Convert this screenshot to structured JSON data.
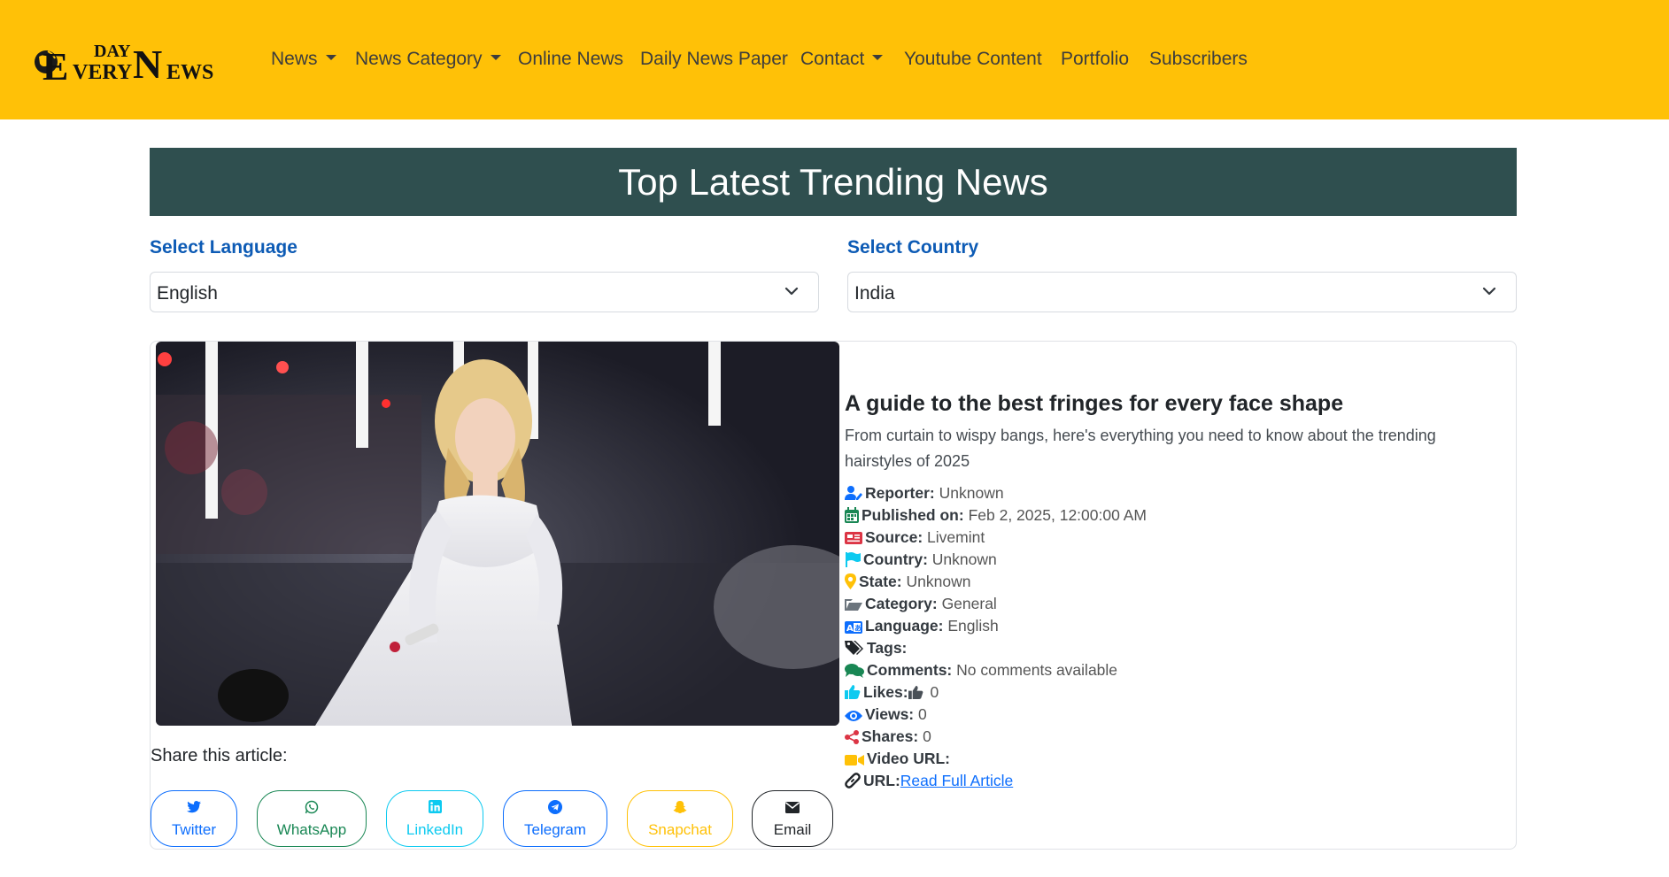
{
  "brand": {
    "logo_text_top": "DAY",
    "logo_text_e": "E",
    "logo_text_very": "VERY",
    "logo_text_n": "N",
    "logo_text_ews": "EWS"
  },
  "nav": {
    "items": [
      {
        "label": "News"
      },
      {
        "label": "News Category"
      },
      {
        "label": "Online News"
      },
      {
        "label": "Daily News Paper"
      },
      {
        "label": "Contact"
      },
      {
        "label": "Youtube Content"
      },
      {
        "label": "Portfolio"
      },
      {
        "label": "Subscribers"
      }
    ]
  },
  "banner": {
    "title": "Top Latest Trending News"
  },
  "filters": {
    "language_label": "Select Language",
    "language_value": "English",
    "country_label": "Select Country",
    "country_value": "India"
  },
  "article": {
    "title": "A guide to the best fringes for every face shape",
    "description": "From curtain to wispy bangs, here's everything you need to know about the trending hairstyles of 2025",
    "reporter_label": "Reporter:",
    "reporter": "Unknown",
    "published_label": "Published on:",
    "published": "Feb 2, 2025, 12:00:00 AM",
    "source_label": "Source:",
    "source": "Livemint",
    "country_label": "Country:",
    "country": "Unknown",
    "state_label": "State:",
    "state": "Unknown",
    "category_label": "Category:",
    "category": "General",
    "language_label": "Language:",
    "language": "English",
    "tags_label": "Tags:",
    "comments_label": "Comments:",
    "comments": "No comments available",
    "likes_label": "Likes:",
    "likes": "0",
    "views_label": "Views:",
    "views": "0",
    "shares_label": "Shares:",
    "shares": "0",
    "video_label": "Video URL:",
    "url_label": "URL:",
    "url_link": "Read Full Article"
  },
  "share": {
    "label": "Share this article:",
    "buttons": [
      {
        "label": "Twitter",
        "icon": "twitter-icon",
        "color": "#0d6efd"
      },
      {
        "label": "WhatsApp",
        "icon": "whatsapp-icon",
        "color": "#198754"
      },
      {
        "label": "LinkedIn",
        "icon": "linkedin-icon",
        "color": "#0dcaf0"
      },
      {
        "label": "Telegram",
        "icon": "telegram-icon",
        "color": "#0d6efd"
      },
      {
        "label": "Snapchat",
        "icon": "snapchat-icon",
        "color": "#ffc107"
      },
      {
        "label": "Email",
        "icon": "envelope-icon",
        "color": "#212529"
      }
    ]
  },
  "colors": {
    "navbar": "#ffc107",
    "banner": "#2f4f4f",
    "link": "#0d6efd",
    "label": "#0d5bb5"
  }
}
